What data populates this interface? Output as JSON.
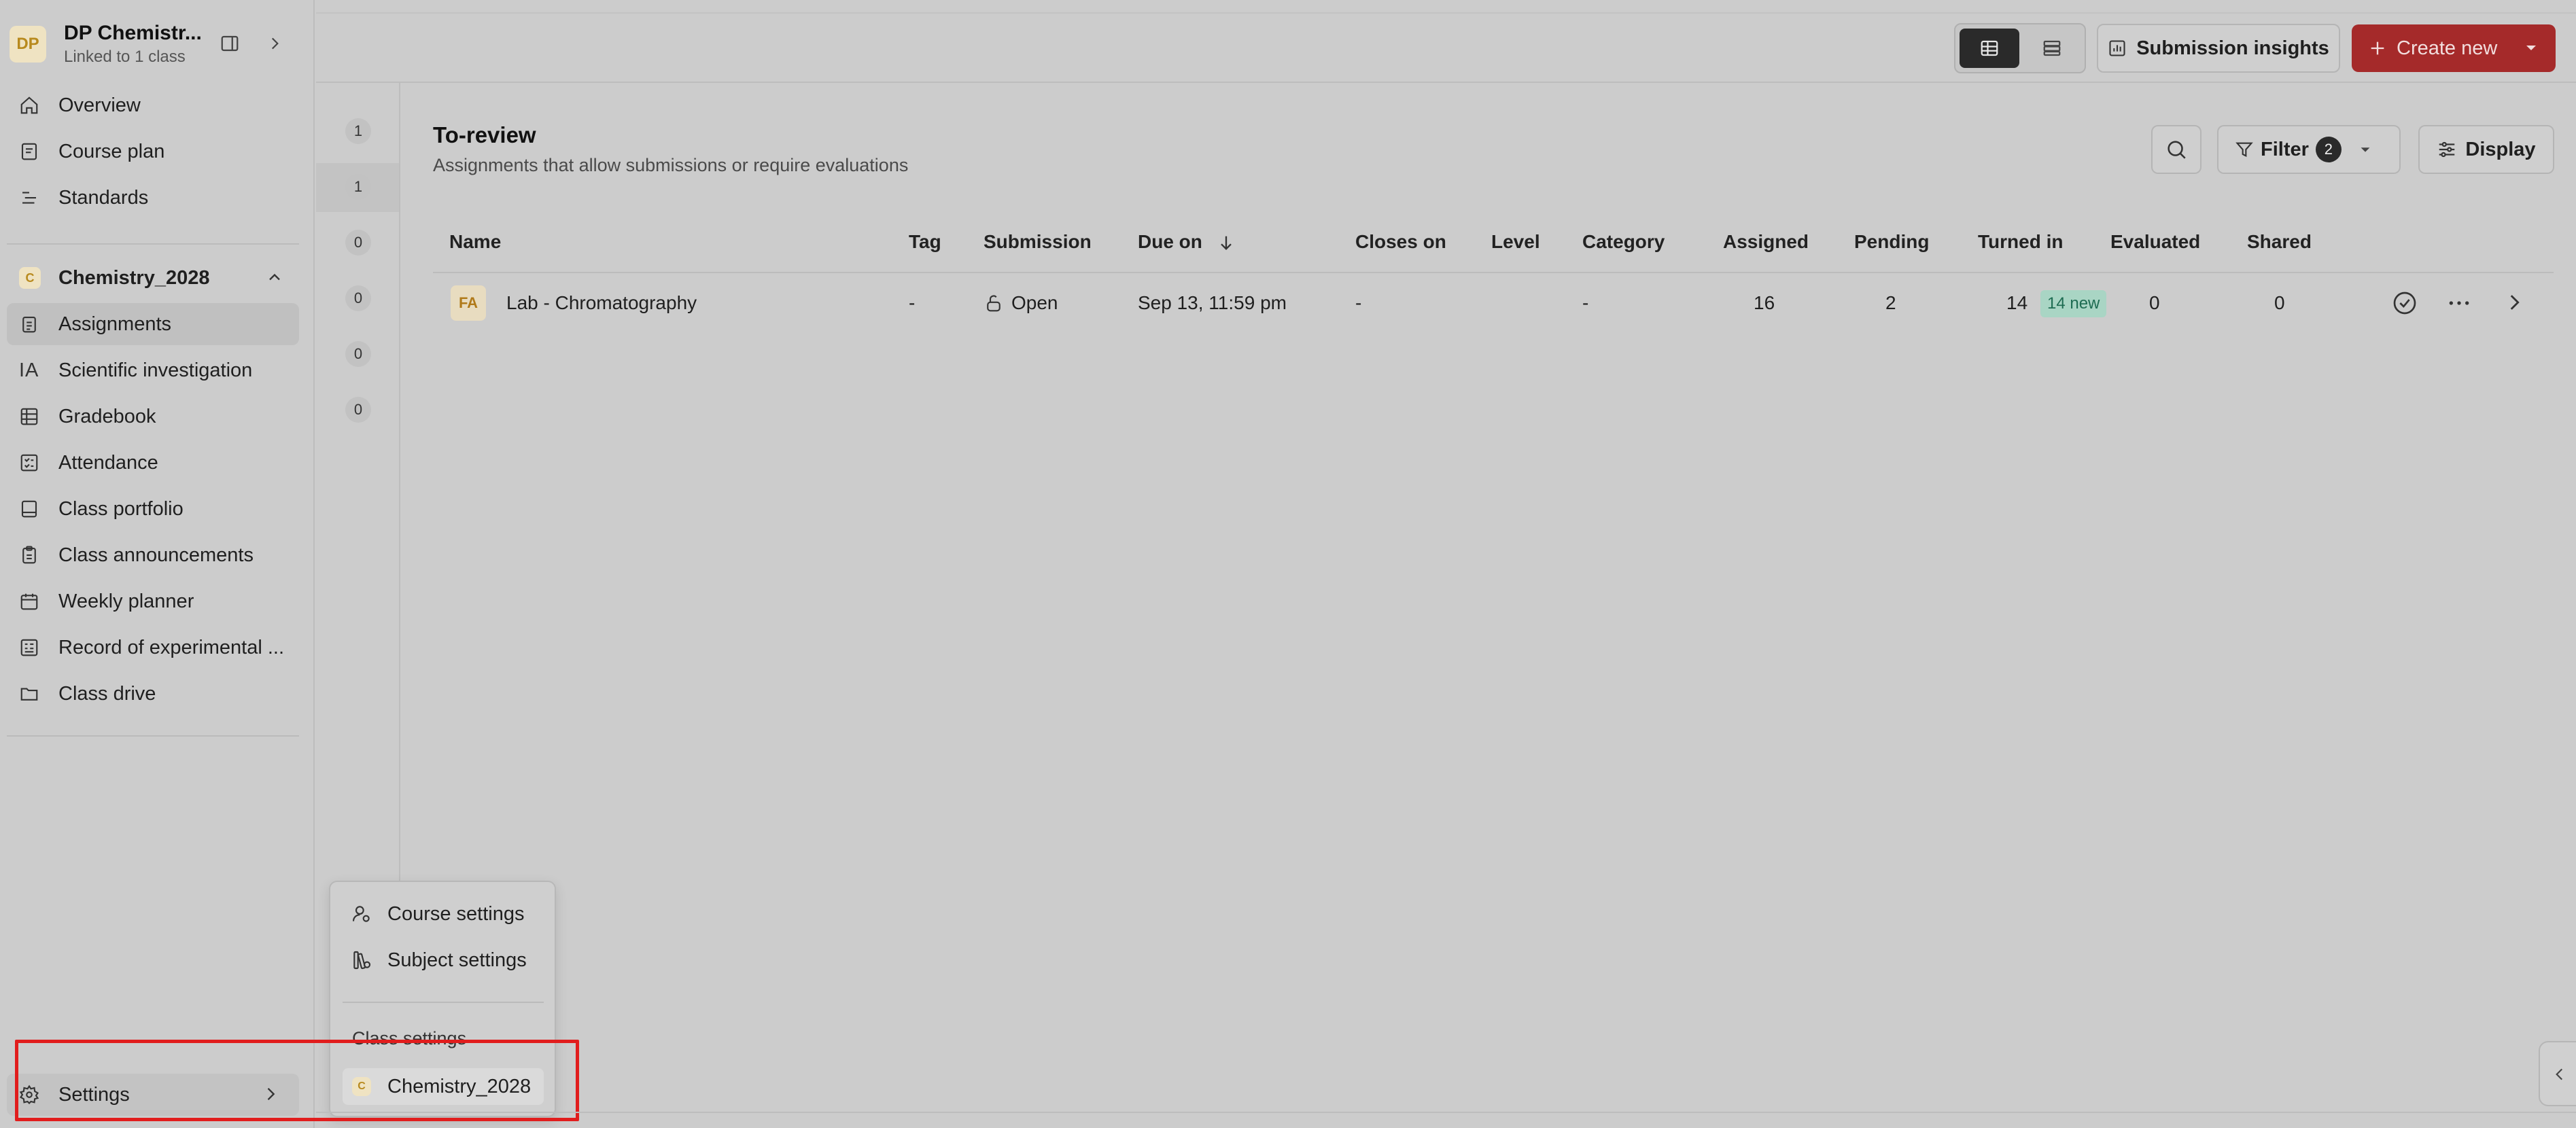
{
  "course": {
    "avatar": "DP",
    "name": "DP Chemistr...",
    "subtitle": "Linked to 1 class"
  },
  "sidebar": {
    "top_items": [
      {
        "label": "Overview",
        "icon": "home-icon"
      },
      {
        "label": "Course plan",
        "icon": "document-icon"
      },
      {
        "label": "Standards",
        "icon": "list-icon"
      }
    ],
    "class": {
      "badge": "C",
      "name": "Chemistry_2028"
    },
    "class_items": [
      {
        "label": "Assignments",
        "icon": "clipboard-icon",
        "active": true
      },
      {
        "label": "Scientific investigation",
        "icon": "ia-icon",
        "glyph": "IA"
      },
      {
        "label": "Gradebook",
        "icon": "grid-icon"
      },
      {
        "label": "Attendance",
        "icon": "checklist-icon"
      },
      {
        "label": "Class portfolio",
        "icon": "portfolio-icon"
      },
      {
        "label": "Class announcements",
        "icon": "announcement-icon"
      },
      {
        "label": "Weekly planner",
        "icon": "calendar-icon"
      },
      {
        "label": "Record of experimental ...",
        "icon": "record-icon"
      },
      {
        "label": "Class drive",
        "icon": "folder-icon"
      }
    ],
    "settings_label": "Settings"
  },
  "counts": [
    "1",
    "1",
    "0",
    "0",
    "0",
    "0"
  ],
  "toolbar": {
    "insights_label": "Submission insights",
    "create_label": "Create new"
  },
  "section": {
    "title": "To-review",
    "subtitle": "Assignments that allow submissions or require evaluations",
    "filter_label": "Filter",
    "filter_count": "2",
    "display_label": "Display"
  },
  "table": {
    "headers": {
      "name": "Name",
      "tag": "Tag",
      "submission": "Submission",
      "due_on": "Due on",
      "closes_on": "Closes on",
      "level": "Level",
      "category": "Category",
      "assigned": "Assigned",
      "pending": "Pending",
      "turned_in": "Turned in",
      "evaluated": "Evaluated",
      "shared": "Shared"
    },
    "rows": [
      {
        "badge": "FA",
        "name": "Lab - Chromatography",
        "tag": "-",
        "submission": "Open",
        "due_on": "Sep 13, 11:59 pm",
        "closes_on": "-",
        "level": "",
        "category": "-",
        "assigned": "16",
        "pending": "2",
        "turned_in": "14",
        "new_badge": "14 new",
        "evaluated": "0",
        "shared": "0"
      }
    ]
  },
  "popover": {
    "items": [
      {
        "label": "Course settings",
        "icon": "course-settings-icon"
      },
      {
        "label": "Subject settings",
        "icon": "subject-settings-icon"
      }
    ],
    "class_settings_label": "Class settings",
    "class_badge": "C",
    "class_name": "Chemistry_2028"
  },
  "colors": {
    "accent": "#a52a2a",
    "highlight": "#e11d1d",
    "new_badge_bg": "#a9d5c4",
    "new_badge_text": "#1e6c52",
    "avatar_bg": "#efe3c2"
  }
}
